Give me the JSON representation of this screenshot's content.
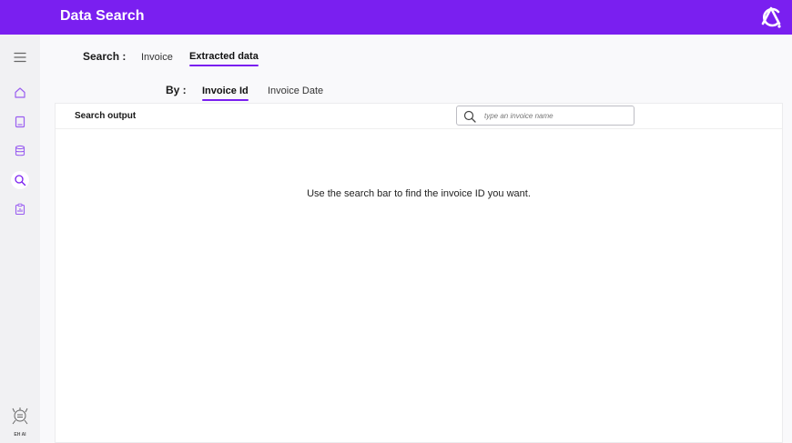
{
  "header": {
    "title": "Data Search",
    "accent_color": "#7a1ff0"
  },
  "sidebar": {
    "items": [
      {
        "icon": "menu-icon",
        "active": false
      },
      {
        "icon": "home-icon",
        "active": false
      },
      {
        "icon": "document-icon",
        "active": false
      },
      {
        "icon": "database-icon",
        "active": false
      },
      {
        "icon": "search-icon",
        "active": true
      },
      {
        "icon": "report-icon",
        "active": false
      }
    ],
    "brand_label": "EH AI"
  },
  "search_type": {
    "label": "Search :",
    "tabs": [
      {
        "label": "Invoice",
        "active": false
      },
      {
        "label": "Extracted data",
        "active": true
      }
    ]
  },
  "search_by": {
    "label": "By :",
    "tabs": [
      {
        "label": "Invoice Id",
        "active": true
      },
      {
        "label": "Invoice Date",
        "active": false
      }
    ]
  },
  "output": {
    "title": "Search output",
    "search_placeholder": "type an invoice name",
    "empty_message": "Use the search bar to find the invoice ID you want."
  }
}
